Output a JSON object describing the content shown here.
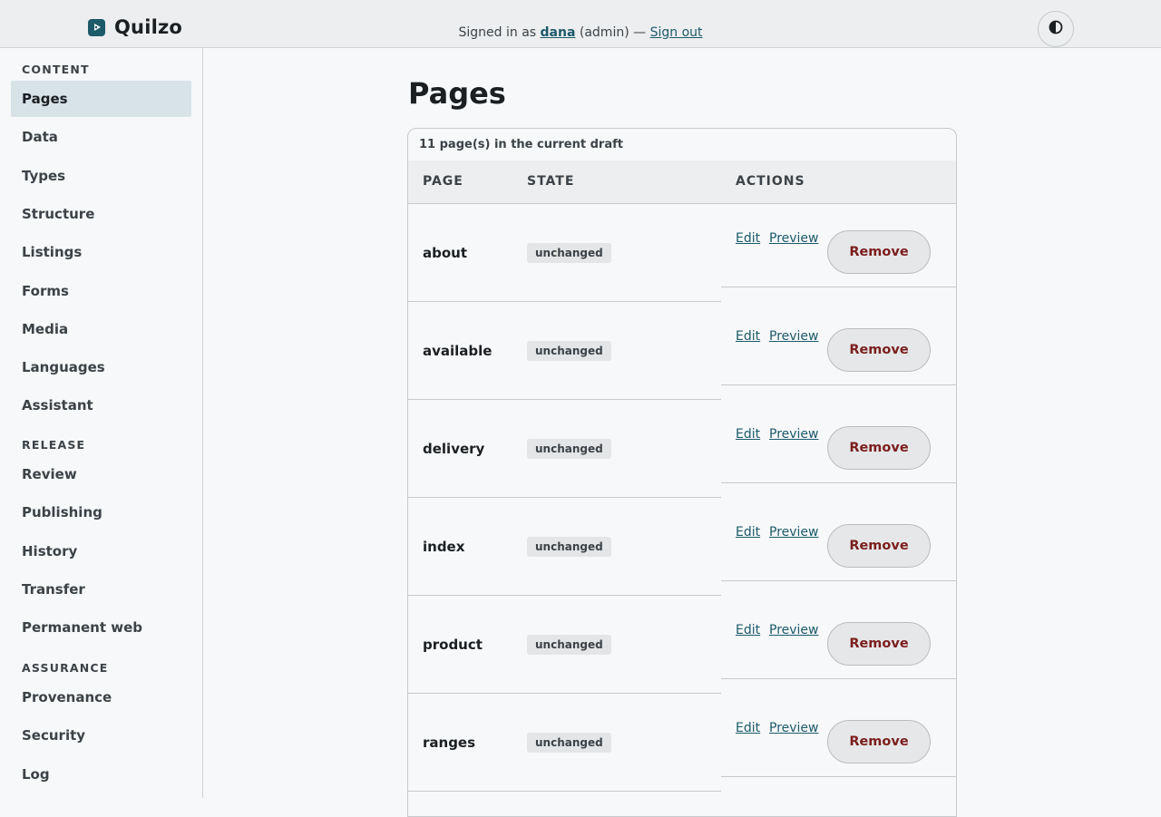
{
  "app": {
    "name": "Quilzo"
  },
  "header": {
    "signin_prefix": "Signed in as",
    "user": "dana",
    "role": "(admin) —",
    "signout": "Sign out"
  },
  "sidebar": {
    "sections": [
      {
        "label": "CONTENT",
        "items": [
          "Pages",
          "Data",
          "Types",
          "Structure",
          "Listings",
          "Forms",
          "Media",
          "Languages",
          "Assistant"
        ]
      },
      {
        "label": "RELEASE",
        "items": [
          "Review",
          "Publishing",
          "History",
          "Transfer",
          "Permanent web"
        ]
      },
      {
        "label": "ASSURANCE",
        "items": [
          "Provenance",
          "Security",
          "Log"
        ]
      }
    ],
    "active": "Pages"
  },
  "main": {
    "title": "Pages",
    "caption": "11 page(s) in the current draft",
    "columns": [
      "PAGE",
      "STATE",
      "ACTIONS"
    ],
    "rows": [
      {
        "name": "about",
        "state": "unchanged"
      },
      {
        "name": "available",
        "state": "unchanged"
      },
      {
        "name": "delivery",
        "state": "unchanged"
      },
      {
        "name": "index",
        "state": "unchanged"
      },
      {
        "name": "product",
        "state": "unchanged"
      },
      {
        "name": "ranges",
        "state": "unchanged"
      }
    ],
    "actions": {
      "edit": "Edit",
      "preview": "Preview",
      "remove": "Remove"
    }
  },
  "icons": {
    "brand": "quilzo-logo-icon",
    "theme": "contrast-icon"
  },
  "colors": {
    "accent": "#1d5a6a",
    "danger": "#7b1e1e",
    "active_nav": "#d7e3e7"
  }
}
